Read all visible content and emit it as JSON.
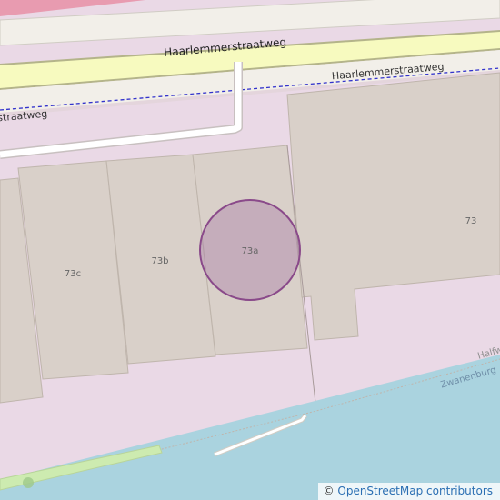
{
  "map": {
    "roads": {
      "main_road_label": "Haarlemmerstraatweg",
      "secondary_road_label_right": "Haarlemmerstraatweg",
      "secondary_road_label_left": "straatweg",
      "fill_color": "#f7fabf",
      "casing_color": "#b4b48a",
      "minor_road_color": "#f2efe9",
      "footpath_color": "#ffffff",
      "boundary_color": "#3333cc"
    },
    "buildings": [
      {
        "label": "73c"
      },
      {
        "label": "73b"
      },
      {
        "label": "73a"
      },
      {
        "label": "73"
      }
    ],
    "water": {
      "labels": [
        "Zwanenburg",
        "Halfw"
      ],
      "color": "#aad3df"
    },
    "landuse": {
      "commercial_color": "#ead9e6",
      "building_color": "#d9d0c9",
      "grass_color": "#cdebb0"
    },
    "marker": {
      "label": "73a",
      "fill_color": "#a06ea0",
      "stroke_color": "#8a4a8a"
    }
  },
  "attribution": {
    "copyright_symbol": "©",
    "text": "OpenStreetMap contributors",
    "link_color": "#2b6fb3"
  }
}
